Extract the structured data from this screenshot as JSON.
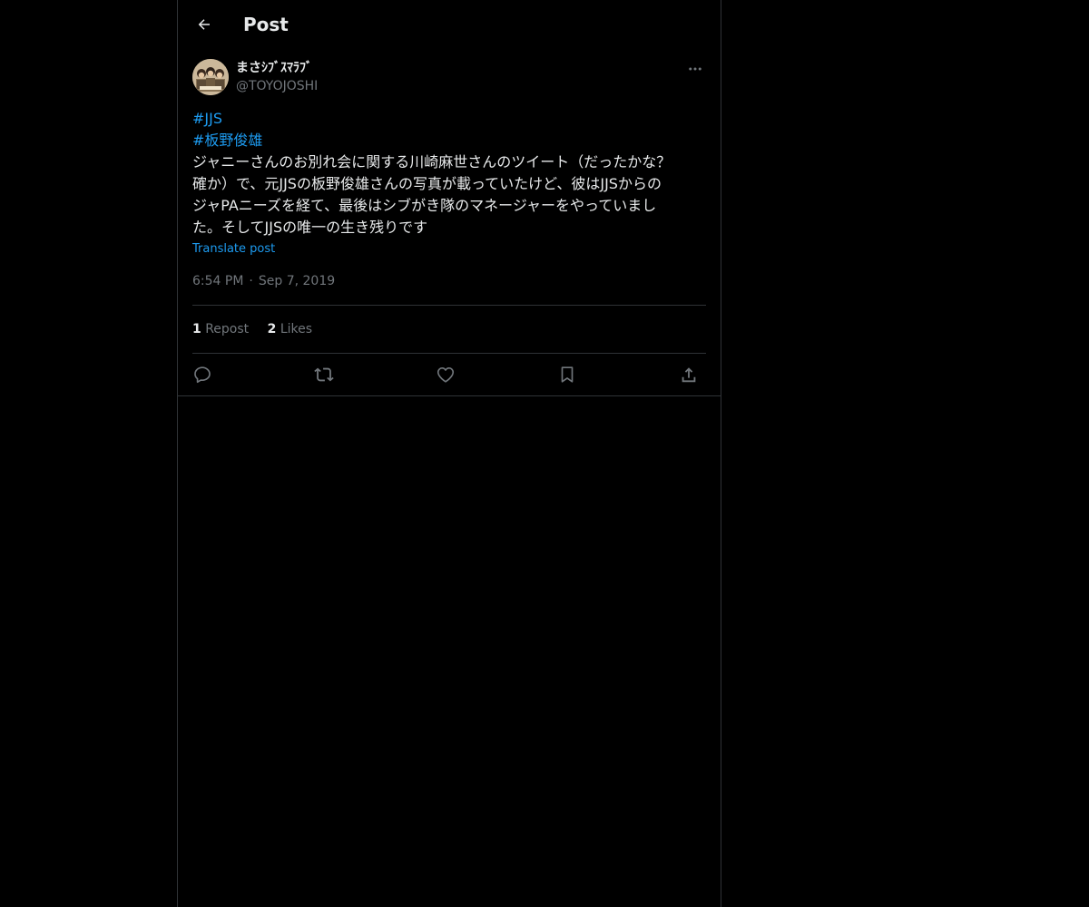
{
  "header": {
    "title": "Post",
    "back_icon": "arrow-left-icon"
  },
  "author": {
    "display_name": "まさｼﾌﾞｽﾏﾗﾌﾞ",
    "handle": "@TOYOJOSHI",
    "more_icon": "more-horizontal-icon"
  },
  "post": {
    "hashtags": [
      "#JJS",
      "#板野俊雄"
    ],
    "text_lines": [
      "ジャニーさんのお別れ会に関する川崎麻世さんのツイート（だったかな？",
      "確か）で、元JJSの板野俊雄さんの写真が載っていたけど、彼はJJSからの",
      "ジャPAニーズを経て、最後はシブがき隊のマネージャーをやっていまし",
      "た。そしてJJSの唯一の生き残りです"
    ],
    "translate_label": "Translate post",
    "time": "6:54 PM",
    "separator": "·",
    "date": "Sep 7, 2019"
  },
  "stats": {
    "reposts_count": "1",
    "reposts_label": "Repost",
    "likes_count": "2",
    "likes_label": "Likes"
  },
  "actions": {
    "reply_icon": "reply-icon",
    "repost_icon": "repost-icon",
    "like_icon": "heart-icon",
    "bookmark_icon": "bookmark-icon",
    "share_icon": "share-icon"
  },
  "colors": {
    "background": "#000000",
    "text": "#e7e9ea",
    "secondary_text": "#71767b",
    "accent": "#1d9bf0",
    "border": "#2f3336"
  }
}
